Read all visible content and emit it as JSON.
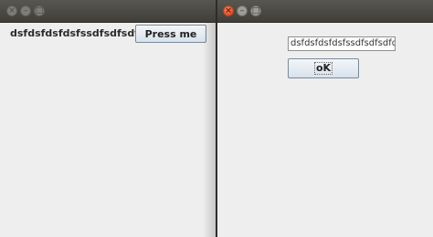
{
  "left_window": {
    "label_text": "dsfdsfdsfdsfssdfsdfsdfd",
    "press_button": "Press me"
  },
  "right_window": {
    "text_field_value": "dsfdsfdsfdsfssdfsdfsdfd",
    "ok_button": "oK"
  },
  "titlebar_icons": {
    "close": "×",
    "minimize": "–",
    "maximize": "□"
  },
  "colors": {
    "titlebar": "#4a4944",
    "window_bg": "#eeeeee",
    "close_active": "#e85a2f"
  }
}
